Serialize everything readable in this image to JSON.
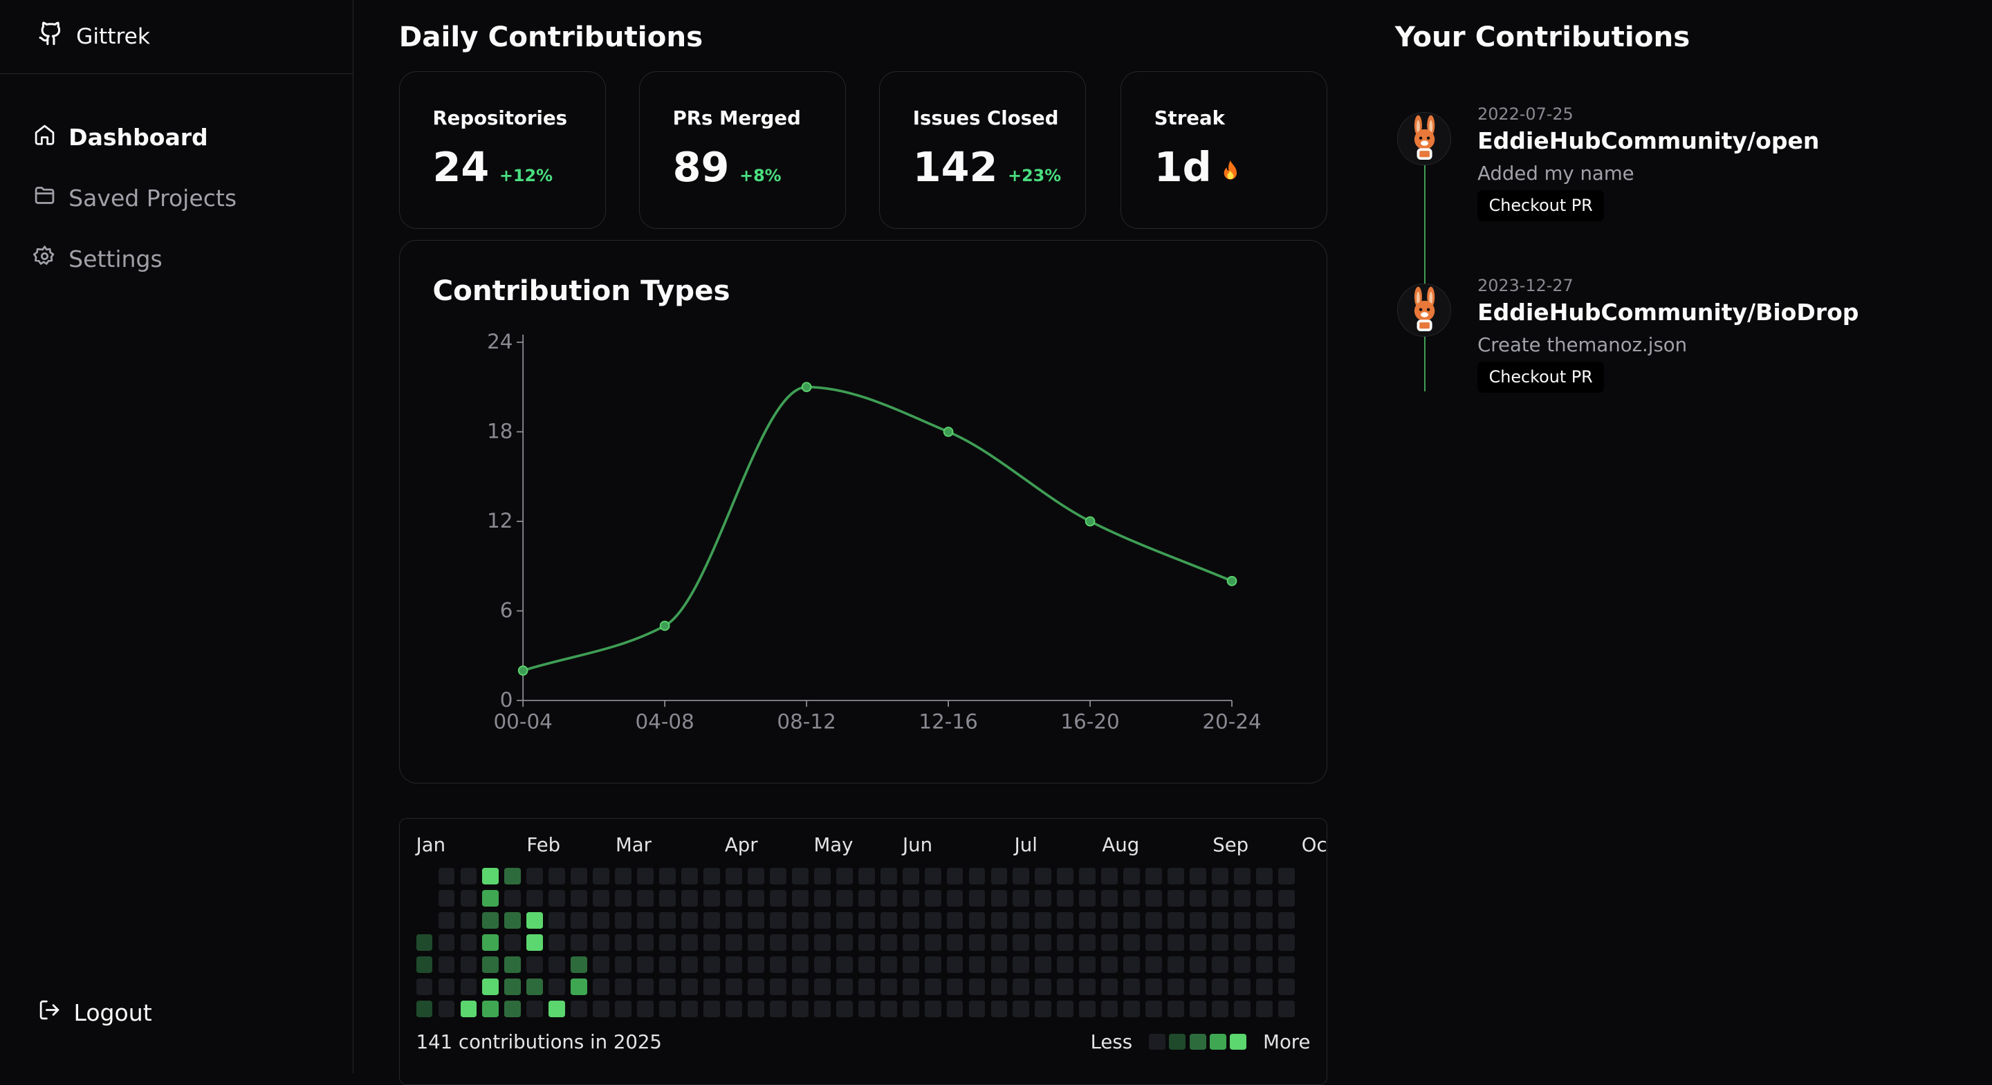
{
  "app": {
    "name": "Gittrek"
  },
  "nav": {
    "items": [
      {
        "label": "Dashboard",
        "icon": "home-icon",
        "active": true
      },
      {
        "label": "Saved Projects",
        "icon": "folder-icon",
        "active": false
      },
      {
        "label": "Settings",
        "icon": "gear-icon",
        "active": false
      }
    ],
    "logout": "Logout"
  },
  "daily": {
    "title": "Daily Contributions"
  },
  "stats": [
    {
      "label": "Repositories",
      "value": "24",
      "delta": "+12%"
    },
    {
      "label": "PRs Merged",
      "value": "89",
      "delta": "+8%"
    },
    {
      "label": "Issues Closed",
      "value": "142",
      "delta": "+23%"
    },
    {
      "label": "Streak",
      "value": "1d",
      "icon": "fire-icon"
    }
  ],
  "chart_data": {
    "type": "line",
    "title": "Contribution Types",
    "categories": [
      "00-04",
      "04-08",
      "08-12",
      "12-16",
      "16-20",
      "20-24"
    ],
    "series": [
      {
        "values": [
          2,
          5,
          21,
          18,
          12,
          8
        ]
      }
    ],
    "ylim": [
      0,
      24
    ],
    "yticks": [
      "0",
      "6",
      "12",
      "18",
      "24"
    ],
    "color": "#3f9e55",
    "grid": false
  },
  "heatmap": {
    "months": [
      "Jan",
      "Feb",
      "Mar",
      "Apr",
      "May",
      "Jun",
      "Jul",
      "Aug",
      "Sep",
      "Oct"
    ],
    "summary": "141 contributions in 2025",
    "legend_less": "Less",
    "legend_more": "More",
    "colors": [
      "#1b1d22",
      "#1f4a2c",
      "#2e6b3c",
      "#3fa752",
      "#5cd66e"
    ],
    "weeks": [
      [
        null,
        null,
        null,
        1,
        1,
        0,
        1
      ],
      [
        0,
        0,
        0,
        0,
        0,
        0,
        0
      ],
      [
        0,
        0,
        0,
        0,
        0,
        0,
        4
      ],
      [
        4,
        3,
        2,
        3,
        2,
        4,
        3
      ],
      [
        2,
        0,
        2,
        0,
        2,
        2,
        2
      ],
      [
        0,
        0,
        4,
        4,
        0,
        2,
        0
      ],
      [
        0,
        0,
        0,
        0,
        0,
        0,
        4
      ],
      [
        0,
        0,
        0,
        0,
        2,
        3,
        0
      ]
    ],
    "total_weeks": 40
  },
  "your": {
    "title": "Your Contributions",
    "entries": [
      {
        "date": "2022-07-25",
        "repo": "EddieHubCommunity/open",
        "message": "Added my name",
        "action": "Checkout PR"
      },
      {
        "date": "2023-12-27",
        "repo": "EddieHubCommunity/BioDrop",
        "message": "Create themanoz.json",
        "action": "Checkout PR"
      }
    ]
  }
}
